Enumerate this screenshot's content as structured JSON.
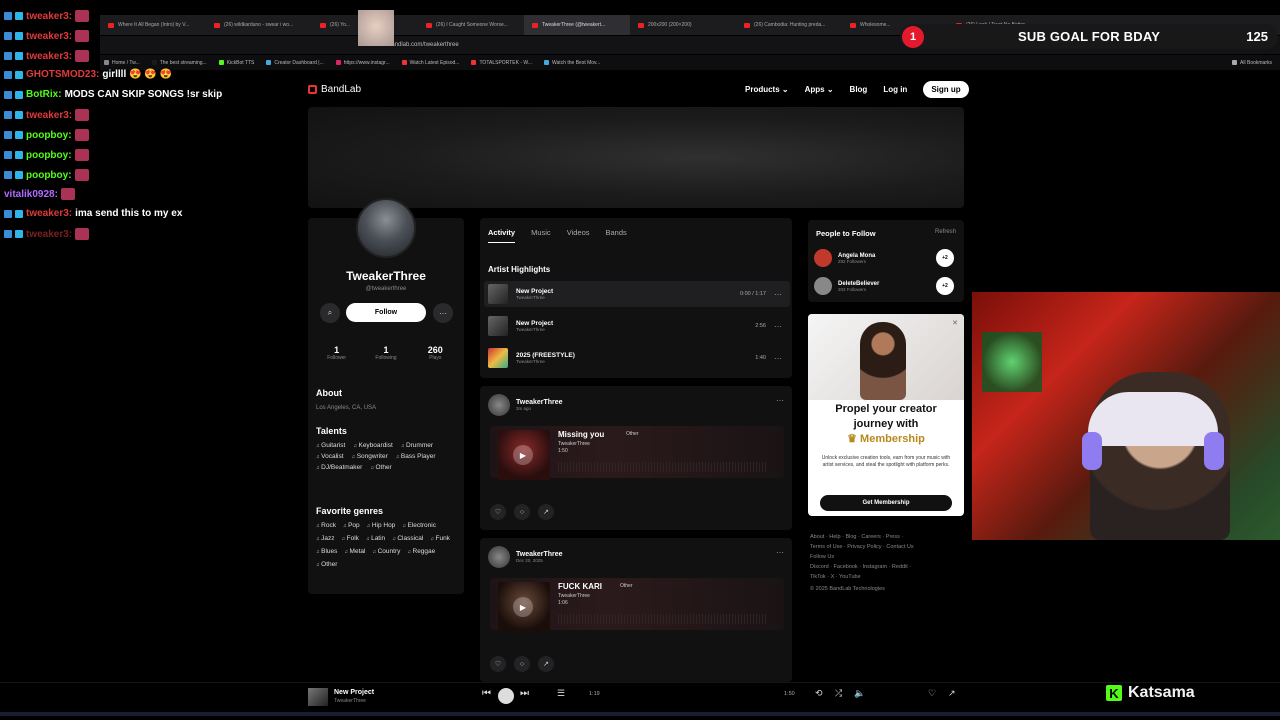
{
  "browser": {
    "tabs": [
      "Where It All Began (Intro) by V...",
      "(26) wildkarduno - swear i wo...",
      "(26) Yo...",
      "(26) I Caught Someone Worse...",
      "TweakerThree (@tweakert...",
      "200x200 (200×200)",
      "(26) Cambodia: Hunting preda...",
      "Wholesome...",
      "(26) Look / Trust No Better..."
    ],
    "active_tab_index": 4,
    "address": "bandlab.com/tweakerthree",
    "bookmarks": [
      "Home / Tw...",
      "The best streaming...",
      "KickBot TTS",
      "Creator Dashboard |...",
      "https://www.instagr...",
      "Watch Latest Episod...",
      "TOTALSPORTEK - W...",
      "Watch the Best Mov...",
      "All Bookmarks"
    ]
  },
  "chat": [
    {
      "user": "tweaker3:",
      "msg": "",
      "color": "#e03a3a",
      "emote": true
    },
    {
      "user": "tweaker3:",
      "msg": "",
      "color": "#e03a3a",
      "emote": true
    },
    {
      "user": "tweaker3:",
      "msg": "",
      "color": "#e03a3a",
      "emote": true
    },
    {
      "user": "GHOTSMOD23:",
      "msg": "girllll 😍 😍 😍",
      "color": "#e03a3a",
      "emote": false
    },
    {
      "user": "BotRix:",
      "msg": "MODS CAN SKIP SONGS !sr skip",
      "color": "#53fc18",
      "emote": false
    },
    {
      "user": "tweaker3:",
      "msg": "",
      "color": "#e03a3a",
      "emote": true
    },
    {
      "user": "poopboy:",
      "msg": "",
      "color": "#53fc18",
      "emote": true
    },
    {
      "user": "poopboy:",
      "msg": "",
      "color": "#53fc18",
      "emote": true
    },
    {
      "user": "poopboy:",
      "msg": "",
      "color": "#53fc18",
      "emote": true
    },
    {
      "user": "vitalik0928:",
      "msg": "",
      "color": "#b06cff",
      "emote": true
    },
    {
      "user": "tweaker3:",
      "msg": "ima send this to my ex",
      "color": "#e03a3a",
      "emote": false
    },
    {
      "user": "tweaker3:",
      "msg": "",
      "color": "#7a2020",
      "emote": true
    }
  ],
  "subgoal": {
    "number": "1",
    "text": "SUB GOAL FOR BDAY",
    "count": "125"
  },
  "bandlab": {
    "logo": "BandLab",
    "nav": {
      "products": "Products",
      "apps": "Apps",
      "blog": "Blog",
      "login": "Log in",
      "signup": "Sign up"
    },
    "profile": {
      "name": "TweakerThree",
      "handle": "@tweakerthree",
      "follow": "Follow",
      "stats": [
        {
          "n": "1",
          "l": "Follower"
        },
        {
          "n": "1",
          "l": "Following"
        },
        {
          "n": "260",
          "l": "Plays"
        }
      ],
      "about_title": "About",
      "location": "Los Angeles, CA, USA",
      "talents_title": "Talents",
      "talents": [
        "Guitarist",
        "Keyboardist",
        "Drummer",
        "Vocalist",
        "Songwriter",
        "Bass Player",
        "DJ/Beatmaker",
        "Other"
      ],
      "genres_title": "Favorite genres",
      "genres": [
        "Rock",
        "Pop",
        "Hip Hop",
        "Electronic",
        "Jazz",
        "Folk",
        "Latin",
        "Classical",
        "Funk",
        "Blues",
        "Metal",
        "Country",
        "Reggae",
        "Other"
      ]
    },
    "tabs": [
      "Activity",
      "Music",
      "Videos",
      "Bands"
    ],
    "highlights_title": "Artist Highlights",
    "highlights": [
      {
        "title": "New Project",
        "artist": "TweakerThree",
        "duration": "0:00 / 1:17"
      },
      {
        "title": "New Project",
        "artist": "TweakerThree",
        "duration": "2:56"
      },
      {
        "title": "2025 (FREESTYLE)",
        "artist": "TweakerThree",
        "duration": "1:40"
      }
    ],
    "posts": [
      {
        "author": "TweakerThree",
        "time": "3m ago",
        "track": "Missing you",
        "genre": "Other",
        "artist": "TweakerThree",
        "duration": "1:50"
      },
      {
        "author": "TweakerThree",
        "time": "Dec 20, 2025",
        "track": "FUCK KARI",
        "genre": "Other",
        "artist": "TweakerThree",
        "duration": "1:06"
      }
    ],
    "people": {
      "title": "People to Follow",
      "refresh": "Refresh",
      "items": [
        {
          "name": "Angela Mona",
          "followers": "292 Followers",
          "color": "#c0392b"
        },
        {
          "name": "DeleteBeliever",
          "followers": "203 Followers",
          "color": "#888888"
        }
      ]
    },
    "promo": {
      "title_1": "Propel your creator",
      "title_2": "journey with",
      "title_gold": "♛ Membership",
      "sub": "Unlock exclusive creation tools, earn from your music with artist services, and steal the spotlight with platform perks.",
      "button": "Get Membership"
    },
    "footer": {
      "line1": "About · Help · Blog · Careers · Press ·",
      "line2": "Terms of Use · Privacy Policy · Contact Us",
      "line3": "Follow Us",
      "line4": "Discord · Facebook · Instagram · Reddit ·",
      "line5": "TikTok · X · YouTube",
      "line6": "© 2025 BandLab Technologies"
    },
    "player": {
      "title": "New Project",
      "artist": "TweakerThree",
      "elapsed": "1:19",
      "total": "1:50"
    }
  },
  "kick": {
    "brand": "Katsama"
  },
  "colors": {
    "accent": "#e3192e",
    "kick_green": "#53fc18"
  }
}
